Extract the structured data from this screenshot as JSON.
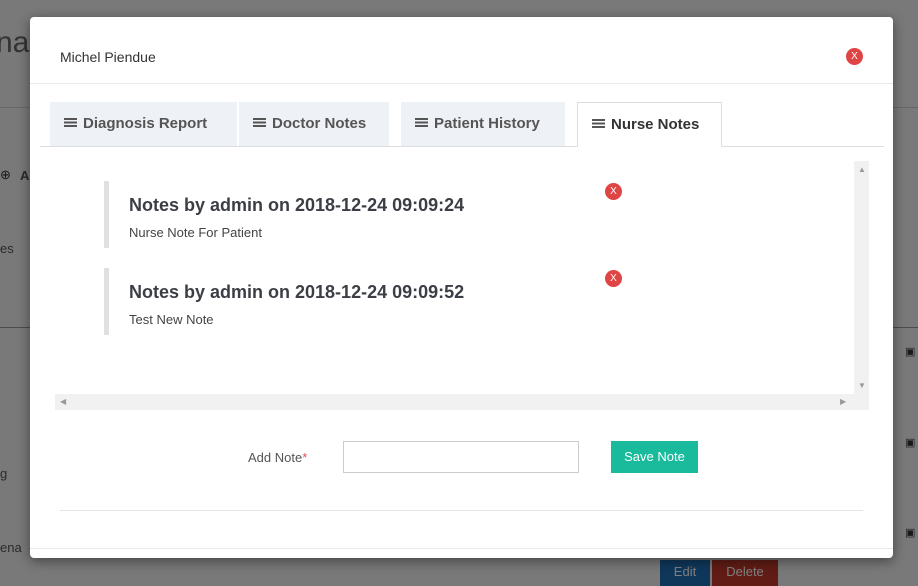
{
  "background": {
    "heading_fragment": "nag",
    "side_texts": [
      "A",
      "es",
      "g",
      "ena"
    ],
    "edit_label": "Edit",
    "delete_label": "Delete"
  },
  "modal": {
    "title": "Michel Piendue",
    "close_label": "X",
    "tabs": [
      {
        "label": "Diagnosis Report",
        "active": false
      },
      {
        "label": "Doctor Notes",
        "active": false
      },
      {
        "label": "Patient History",
        "active": false
      },
      {
        "label": "Nurse Notes",
        "active": true
      }
    ],
    "notes": [
      {
        "title": "Notes by admin on 2018-12-24 09:09:24",
        "text": "Nurse Note For Patient",
        "delete_label": "X"
      },
      {
        "title": "Notes by admin on 2018-12-24 09:09:52",
        "text": "Test New Note",
        "delete_label": "X"
      }
    ],
    "form": {
      "label": "Add Note",
      "required_mark": "*",
      "input_value": "",
      "input_placeholder": "",
      "save_label": "Save Note"
    }
  },
  "colors": {
    "accent": "#1abb9c",
    "danger": "#e04545"
  }
}
